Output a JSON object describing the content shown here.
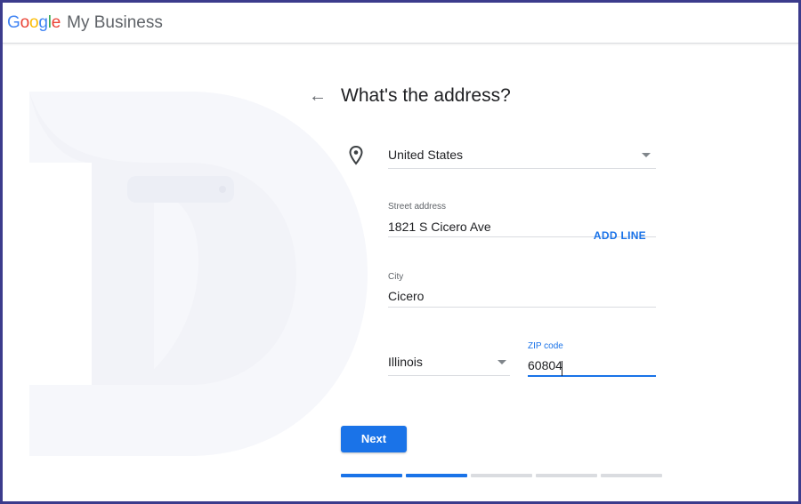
{
  "header": {
    "logo_letters": [
      {
        "char": "G",
        "color": "#4285F4"
      },
      {
        "char": "o",
        "color": "#EA4335"
      },
      {
        "char": "o",
        "color": "#FBBC05"
      },
      {
        "char": "g",
        "color": "#4285F4"
      },
      {
        "char": "l",
        "color": "#34A853"
      },
      {
        "char": "e",
        "color": "#EA4335"
      }
    ],
    "product": "My Business"
  },
  "page": {
    "title": "What's the address?",
    "back_icon": "arrow-left-icon",
    "pin_icon": "location-pin-icon"
  },
  "form": {
    "country": "United States",
    "street_label": "Street address",
    "street_value": "1821 S Cicero Ave",
    "add_line": "ADD LINE",
    "city_label": "City",
    "city_value": "Cicero",
    "state_value": "Illinois",
    "zip_label": "ZIP code",
    "zip_value": "60804"
  },
  "actions": {
    "next_label": "Next"
  },
  "progress": {
    "total_steps": 5,
    "completed_steps": 2
  },
  "colors": {
    "accent": "#1a73e8",
    "frame": "#3b3b8c"
  }
}
